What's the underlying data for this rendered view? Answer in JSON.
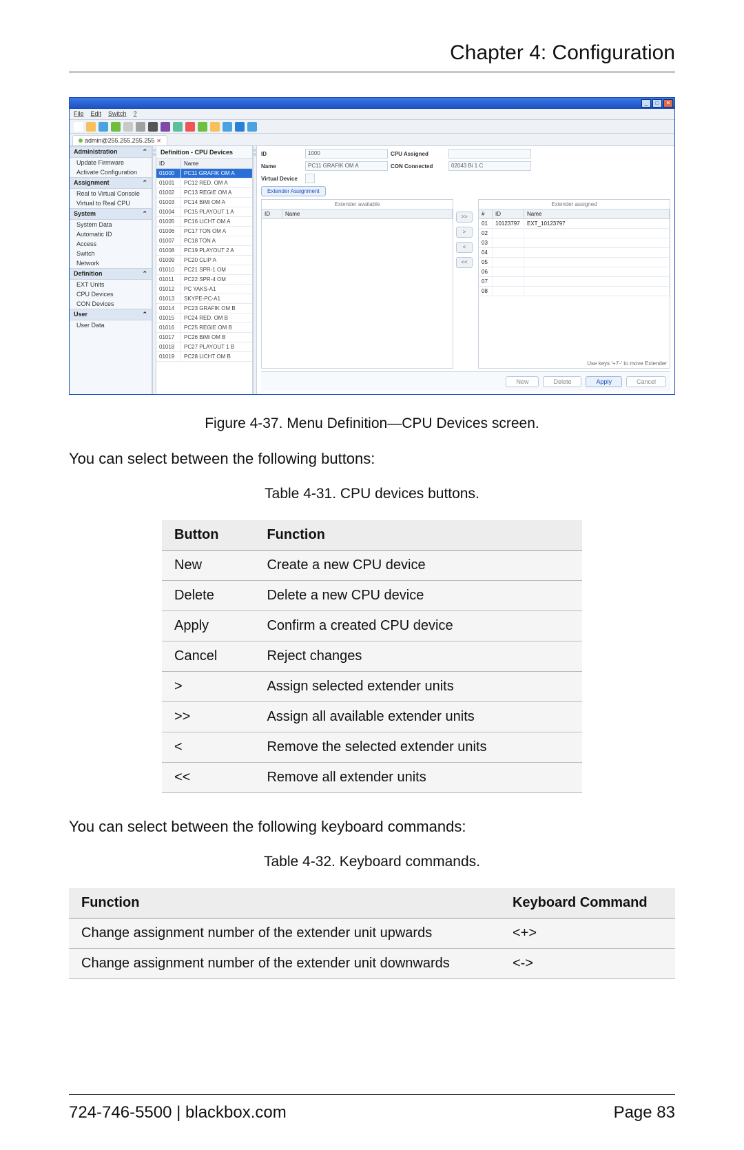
{
  "chapter": "Chapter 4: Configuration",
  "window": {
    "menu": [
      "File",
      "Edit",
      "Switch",
      "?"
    ],
    "tab_label": "admin@255.255.255.255",
    "toolbar_colors": [
      "#ffffff",
      "#f6c05a",
      "#4aa3e0",
      "#6fbf3f",
      "#c9c9c9",
      "#a0a0a0",
      "#555",
      "#7d4aa8",
      "#5bbf9e",
      "#e55",
      "#6fbf3f",
      "#f6c05a",
      "#4aa3e0",
      "#2a7fd6",
      "#4aa3e0"
    ]
  },
  "sidebar": {
    "sections": [
      {
        "title": "Administration",
        "items": [
          "Update Firmware",
          "Activate Configuration"
        ]
      },
      {
        "title": "Assignment",
        "items": [
          "Real to Virtual Console",
          "Virtual to Real CPU"
        ]
      },
      {
        "title": "System",
        "items": [
          "System Data",
          "Automatic ID",
          "Access",
          "Switch",
          "Network"
        ]
      },
      {
        "title": "Definition",
        "items": [
          "EXT Units",
          "CPU Devices",
          "CON Devices"
        ]
      },
      {
        "title": "User",
        "items": [
          "User Data"
        ]
      }
    ]
  },
  "panel_title": "Definition - CPU Devices",
  "devlist": {
    "head_id": "ID",
    "head_name": "Name",
    "rows": [
      {
        "id": "01000",
        "name": "PC11 GRAFIK OM A",
        "sel": true
      },
      {
        "id": "01001",
        "name": "PC12 RED. OM  A"
      },
      {
        "id": "01002",
        "name": "PC13 REGIE OM  A"
      },
      {
        "id": "01003",
        "name": "PC14 BiMi OM  A"
      },
      {
        "id": "01004",
        "name": "PC15 PLAYOUT 1 A"
      },
      {
        "id": "01005",
        "name": "PC16 LICHT OM  A"
      },
      {
        "id": "01006",
        "name": "PC17 TON OM  A"
      },
      {
        "id": "01007",
        "name": "PC18 TON   A"
      },
      {
        "id": "01008",
        "name": "PC19 PLAYOUT 2 A"
      },
      {
        "id": "01009",
        "name": "PC20 CLIP   A"
      },
      {
        "id": "01010",
        "name": "PC21 SPR-1 OM"
      },
      {
        "id": "01011",
        "name": "PC22 SPR-4 OM"
      },
      {
        "id": "01012",
        "name": "PC YAKS-A1"
      },
      {
        "id": "01013",
        "name": "SKYPE-PC-A1"
      },
      {
        "id": "01014",
        "name": "PC23 GRAFIK OM B"
      },
      {
        "id": "01015",
        "name": "PC24 RED. OM  B"
      },
      {
        "id": "01016",
        "name": "PC25 REGIE OM  B"
      },
      {
        "id": "01017",
        "name": "PC26 BiMi OM  B"
      },
      {
        "id": "01018",
        "name": "PC27 PLAYOUT 1 B"
      },
      {
        "id": "01019",
        "name": "PC28 LICHT OM  B"
      }
    ]
  },
  "form": {
    "id_label": "ID",
    "id_value": "1000",
    "cpu_label": "CPU Assigned",
    "cpu_value": "",
    "name_label": "Name",
    "name_value": "PC11 GRAFIK OM A",
    "con_label": "CON Connected",
    "con_value": "02043  Bi 1 C",
    "vd_label": "Virtual Device",
    "tab": "Extender Assignment",
    "left_title": "Extender available",
    "right_title": "Extender assigned",
    "col_id": "ID",
    "col_name": "Name",
    "col_num": "#",
    "assigned": [
      {
        "num": "01",
        "id": "10123797",
        "name": "EXT_10123797"
      }
    ],
    "empty_rows": [
      "02",
      "03",
      "04",
      "05",
      "06",
      "07",
      "08"
    ],
    "hint": "Use keys '+'/'-' to move Extender",
    "move": [
      ">>",
      ">",
      "<",
      "<<"
    ]
  },
  "actions": {
    "new": "New",
    "delete": "Delete",
    "apply": "Apply",
    "cancel": "Cancel"
  },
  "fig_caption": "Figure 4-37. Menu Definition—CPU Devices screen.",
  "para1": "You can select between the following buttons:",
  "table1_caption": "Table 4-31. CPU devices buttons.",
  "table1": {
    "head": [
      "Button",
      "Function"
    ],
    "rows": [
      [
        "New",
        "Create a new CPU device"
      ],
      [
        "Delete",
        "Delete a new CPU device"
      ],
      [
        "Apply",
        "Confirm a created CPU device"
      ],
      [
        "Cancel",
        "Reject changes"
      ],
      [
        ">",
        "Assign selected extender units"
      ],
      [
        ">>",
        "Assign all available extender units"
      ],
      [
        "<",
        "Remove the selected extender units"
      ],
      [
        "<<",
        "Remove all extender units"
      ]
    ]
  },
  "para2": "You can select between the following keyboard commands:",
  "table2_caption": "Table 4-32. Keyboard commands.",
  "table2": {
    "head": [
      "Function",
      "Keyboard Command"
    ],
    "rows": [
      [
        "Change assignment number of the extender unit upwards",
        "<+>"
      ],
      [
        "Change assignment number of the extender unit downwards",
        "<->"
      ]
    ]
  },
  "footer": {
    "left": "724-746-5500   |   blackbox.com",
    "right": "Page 83"
  }
}
